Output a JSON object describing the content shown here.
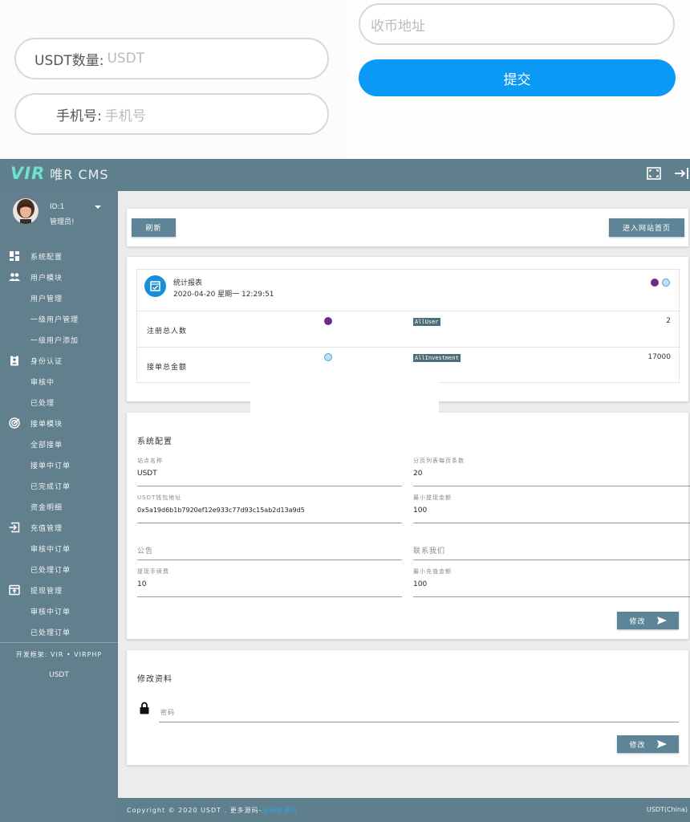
{
  "top_form": {
    "usdt_label": "USDT数量:",
    "usdt_placeholder": "USDT",
    "phone_label": "手机号:",
    "phone_placeholder": "手机号",
    "address_placeholder": "收币地址",
    "submit_label": "提交",
    "submit_color": "#0a9af5"
  },
  "header": {
    "brand_vir": "VIR",
    "brand_rest": "唯R CMS",
    "icons": [
      "fullscreen-icon",
      "logout-icon"
    ]
  },
  "sidebar": {
    "user_id": "ID:1",
    "user_role": "管理员!",
    "nav": [
      {
        "label": "系统配置",
        "icon": "dashboard-icon"
      },
      {
        "label": "用户模块",
        "icon": "users-icon"
      },
      {
        "label": "用户管理"
      },
      {
        "label": "一级用户管理"
      },
      {
        "label": "一级用户添加"
      },
      {
        "label": "身份认证",
        "icon": "id-badge-icon"
      },
      {
        "label": "审核中"
      },
      {
        "label": "已处理"
      },
      {
        "label": "接单模块",
        "icon": "radar-icon"
      },
      {
        "label": "全部接单"
      },
      {
        "label": "接单中订单"
      },
      {
        "label": "已完成订单"
      },
      {
        "label": "资金明细"
      },
      {
        "label": "充值管理",
        "icon": "login-box-icon"
      },
      {
        "label": "审核中订单"
      },
      {
        "label": "已处理订单"
      },
      {
        "label": "提现管理",
        "icon": "withdraw-icon"
      },
      {
        "label": "审核中订单"
      },
      {
        "label": "已处理订单"
      }
    ],
    "dev_frame": "开发框架: VIR • VIRPHP",
    "dev_name": "USDT"
  },
  "toolbar": {
    "refresh_label": "刷新",
    "home_label": "进入网站首页"
  },
  "stats": {
    "title": "统计报表",
    "time": "2020-04-20  星期一 12:29:51",
    "rows": [
      {
        "label": "注册总人数",
        "tag": "AllUser",
        "value": "2"
      },
      {
        "label": "接单总金额",
        "tag": "AllInvestment",
        "value": "17000"
      }
    ]
  },
  "config": {
    "title": "系统配置",
    "fields": [
      {
        "label": "站点名称",
        "value": "USDT"
      },
      {
        "label": "分页列表每页条数",
        "value": "20"
      },
      {
        "label": "USDT钱包地址",
        "value": "0x5a19d6b1b7920ef12e933c77d93c15ab2d13a9d5"
      },
      {
        "label": "最小提现金额",
        "value": "100"
      },
      {
        "placeholder": "公告"
      },
      {
        "placeholder": "联系我们"
      },
      {
        "label": "提现手续费",
        "value": "10"
      },
      {
        "label": "最小充值金额",
        "value": "100"
      }
    ],
    "submit_label": "修改"
  },
  "profile": {
    "title": "修改资料",
    "password_placeholder": "密码",
    "submit_label": "修改"
  },
  "footer": {
    "copyright": "Copyright © 2020 USDT . 更多源码-",
    "link": "源码资源站",
    "right": "USDT(China)"
  },
  "colors": {
    "theme": "#5f7f8d",
    "accent": "#6fe2c9",
    "button": "#5e8597"
  }
}
